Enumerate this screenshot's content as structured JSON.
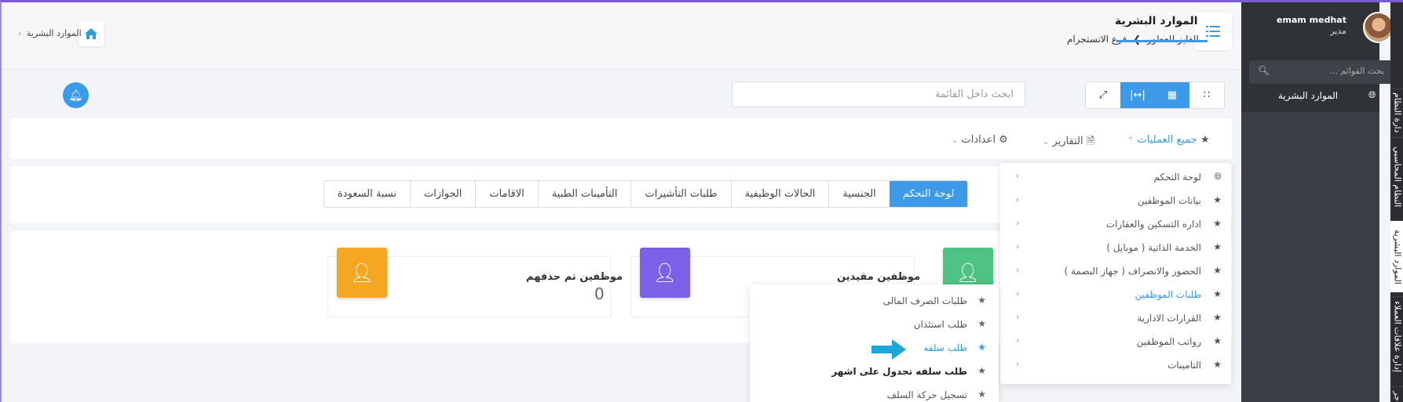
{
  "header": {
    "title": "الموارد البشرية",
    "breadcrumb_company": "الفايز للعطور",
    "breadcrumb_branch": "فرع الانستجرام",
    "left_breadcrumb": "الموارد البشرية"
  },
  "toolbar": {
    "search_placeholder": "ابحث داخل القائمة"
  },
  "modules": {
    "all_ops": "جميع العمليات",
    "reports": "التقارير",
    "settings": "اعدادات"
  },
  "tabs": [
    "لوحة التحكم",
    "الجنسية",
    "الحالات الوظيفية",
    "طلبات التأشيرات",
    "التأمينات الطبية",
    "الاقامات",
    "الجوازات",
    "نسبة السعودة"
  ],
  "stats": [
    {
      "title": "موظفين مقيدين",
      "value": "",
      "color": "#7b61e8"
    },
    {
      "title": "موظفين تم حذفهم",
      "value": "0",
      "color": "#f5a623"
    },
    {
      "title": "",
      "value": "",
      "color": "#4fc383"
    }
  ],
  "dropdown": [
    {
      "label": "لوحة التحكم",
      "icon": "globe-icon"
    },
    {
      "label": "بيانات الموظفين",
      "icon": "star-icon"
    },
    {
      "label": "اداره التسكين والعقارات",
      "icon": "star-icon"
    },
    {
      "label": "الخدمة الذاتية ( موبايل )",
      "icon": "star-icon"
    },
    {
      "label": "الحضور والانصراف ( جهاز البصمة )",
      "icon": "star-icon"
    },
    {
      "label": "طلبات الموظفين",
      "icon": "star-icon",
      "active": true
    },
    {
      "label": "القرارات الادارية",
      "icon": "star-icon"
    },
    {
      "label": "رواتب الموظفين",
      "icon": "star-icon"
    },
    {
      "label": "التامينات",
      "icon": "star-icon"
    }
  ],
  "submenu": [
    {
      "label": "طلبات الصرف المالى"
    },
    {
      "label": "طلب استئذان"
    },
    {
      "label": "طلب سلفه",
      "active": true
    },
    {
      "label": "طلب سلفه تجدول على اشهر",
      "bold": true
    },
    {
      "label": "تسجيل حركة السلف"
    }
  ],
  "sidebar": {
    "user_name": "emam medhat",
    "user_role": "مدير",
    "search_placeholder": "بحث القوائم ...",
    "item": "الموارد البشرية",
    "vertical_tabs": [
      "دارة النظام",
      "النظام المحاسبي",
      "الموارد البشرية",
      "إدارة علاقات العملاء",
      "جر"
    ]
  },
  "colors": {
    "accent": "#3d9ae8",
    "sidebar": "#3a3d44"
  }
}
